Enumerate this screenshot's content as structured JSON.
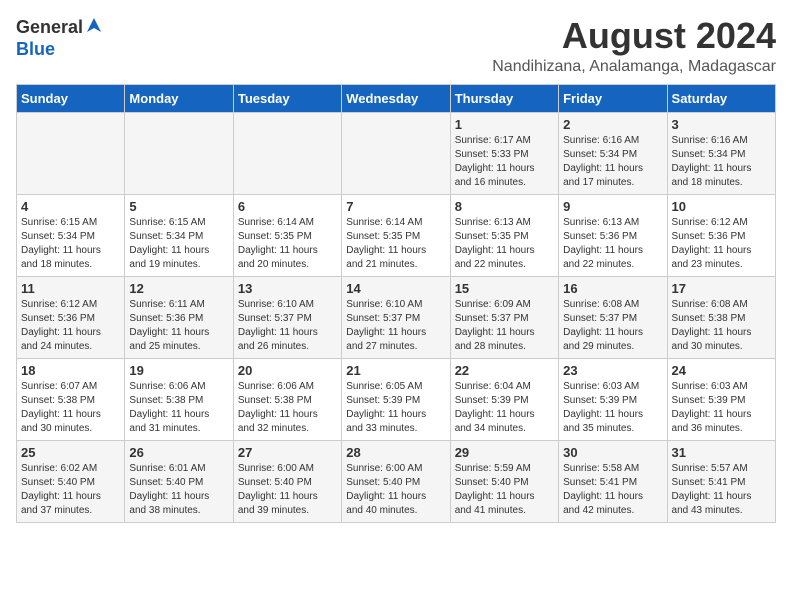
{
  "logo": {
    "general": "General",
    "blue": "Blue"
  },
  "title": "August 2024",
  "subtitle": "Nandihizana, Analamanga, Madagascar",
  "days_of_week": [
    "Sunday",
    "Monday",
    "Tuesday",
    "Wednesday",
    "Thursday",
    "Friday",
    "Saturday"
  ],
  "weeks": [
    [
      {
        "day": "",
        "info": ""
      },
      {
        "day": "",
        "info": ""
      },
      {
        "day": "",
        "info": ""
      },
      {
        "day": "",
        "info": ""
      },
      {
        "day": "1",
        "info": "Sunrise: 6:17 AM\nSunset: 5:33 PM\nDaylight: 11 hours\nand 16 minutes."
      },
      {
        "day": "2",
        "info": "Sunrise: 6:16 AM\nSunset: 5:34 PM\nDaylight: 11 hours\nand 17 minutes."
      },
      {
        "day": "3",
        "info": "Sunrise: 6:16 AM\nSunset: 5:34 PM\nDaylight: 11 hours\nand 18 minutes."
      }
    ],
    [
      {
        "day": "4",
        "info": "Sunrise: 6:15 AM\nSunset: 5:34 PM\nDaylight: 11 hours\nand 18 minutes."
      },
      {
        "day": "5",
        "info": "Sunrise: 6:15 AM\nSunset: 5:34 PM\nDaylight: 11 hours\nand 19 minutes."
      },
      {
        "day": "6",
        "info": "Sunrise: 6:14 AM\nSunset: 5:35 PM\nDaylight: 11 hours\nand 20 minutes."
      },
      {
        "day": "7",
        "info": "Sunrise: 6:14 AM\nSunset: 5:35 PM\nDaylight: 11 hours\nand 21 minutes."
      },
      {
        "day": "8",
        "info": "Sunrise: 6:13 AM\nSunset: 5:35 PM\nDaylight: 11 hours\nand 22 minutes."
      },
      {
        "day": "9",
        "info": "Sunrise: 6:13 AM\nSunset: 5:36 PM\nDaylight: 11 hours\nand 22 minutes."
      },
      {
        "day": "10",
        "info": "Sunrise: 6:12 AM\nSunset: 5:36 PM\nDaylight: 11 hours\nand 23 minutes."
      }
    ],
    [
      {
        "day": "11",
        "info": "Sunrise: 6:12 AM\nSunset: 5:36 PM\nDaylight: 11 hours\nand 24 minutes."
      },
      {
        "day": "12",
        "info": "Sunrise: 6:11 AM\nSunset: 5:36 PM\nDaylight: 11 hours\nand 25 minutes."
      },
      {
        "day": "13",
        "info": "Sunrise: 6:10 AM\nSunset: 5:37 PM\nDaylight: 11 hours\nand 26 minutes."
      },
      {
        "day": "14",
        "info": "Sunrise: 6:10 AM\nSunset: 5:37 PM\nDaylight: 11 hours\nand 27 minutes."
      },
      {
        "day": "15",
        "info": "Sunrise: 6:09 AM\nSunset: 5:37 PM\nDaylight: 11 hours\nand 28 minutes."
      },
      {
        "day": "16",
        "info": "Sunrise: 6:08 AM\nSunset: 5:37 PM\nDaylight: 11 hours\nand 29 minutes."
      },
      {
        "day": "17",
        "info": "Sunrise: 6:08 AM\nSunset: 5:38 PM\nDaylight: 11 hours\nand 30 minutes."
      }
    ],
    [
      {
        "day": "18",
        "info": "Sunrise: 6:07 AM\nSunset: 5:38 PM\nDaylight: 11 hours\nand 30 minutes."
      },
      {
        "day": "19",
        "info": "Sunrise: 6:06 AM\nSunset: 5:38 PM\nDaylight: 11 hours\nand 31 minutes."
      },
      {
        "day": "20",
        "info": "Sunrise: 6:06 AM\nSunset: 5:38 PM\nDaylight: 11 hours\nand 32 minutes."
      },
      {
        "day": "21",
        "info": "Sunrise: 6:05 AM\nSunset: 5:39 PM\nDaylight: 11 hours\nand 33 minutes."
      },
      {
        "day": "22",
        "info": "Sunrise: 6:04 AM\nSunset: 5:39 PM\nDaylight: 11 hours\nand 34 minutes."
      },
      {
        "day": "23",
        "info": "Sunrise: 6:03 AM\nSunset: 5:39 PM\nDaylight: 11 hours\nand 35 minutes."
      },
      {
        "day": "24",
        "info": "Sunrise: 6:03 AM\nSunset: 5:39 PM\nDaylight: 11 hours\nand 36 minutes."
      }
    ],
    [
      {
        "day": "25",
        "info": "Sunrise: 6:02 AM\nSunset: 5:40 PM\nDaylight: 11 hours\nand 37 minutes."
      },
      {
        "day": "26",
        "info": "Sunrise: 6:01 AM\nSunset: 5:40 PM\nDaylight: 11 hours\nand 38 minutes."
      },
      {
        "day": "27",
        "info": "Sunrise: 6:00 AM\nSunset: 5:40 PM\nDaylight: 11 hours\nand 39 minutes."
      },
      {
        "day": "28",
        "info": "Sunrise: 6:00 AM\nSunset: 5:40 PM\nDaylight: 11 hours\nand 40 minutes."
      },
      {
        "day": "29",
        "info": "Sunrise: 5:59 AM\nSunset: 5:40 PM\nDaylight: 11 hours\nand 41 minutes."
      },
      {
        "day": "30",
        "info": "Sunrise: 5:58 AM\nSunset: 5:41 PM\nDaylight: 11 hours\nand 42 minutes."
      },
      {
        "day": "31",
        "info": "Sunrise: 5:57 AM\nSunset: 5:41 PM\nDaylight: 11 hours\nand 43 minutes."
      }
    ]
  ]
}
